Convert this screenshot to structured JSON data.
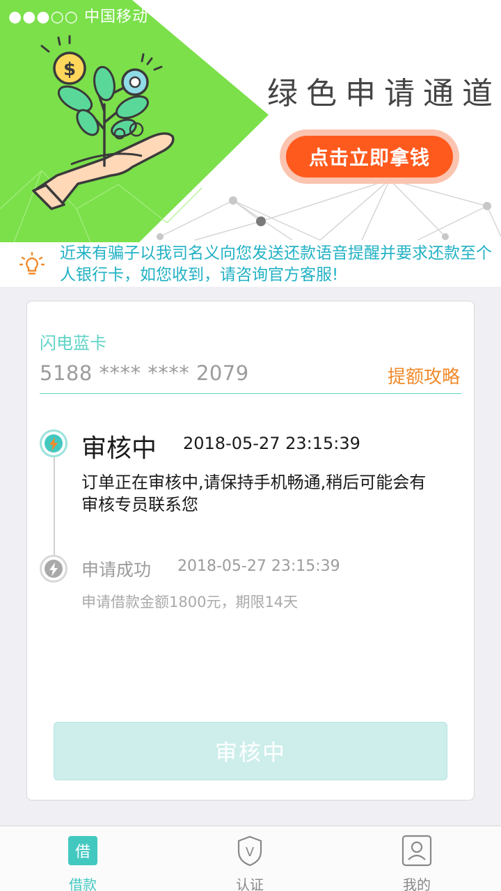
{
  "status_bar": {
    "carrier": "●●●○○ 中国移动"
  },
  "banner": {
    "title": "绿色申请通道",
    "cta_label": "点击立即拿钱",
    "colors": {
      "green": "#7be04a",
      "cta": "#ff5a1e"
    }
  },
  "notice": {
    "icon": "lightbulb-icon",
    "text": "近来有骗子以我司名义向您发送还款语音提醒并要求还款至个人银行卡，如您收到，请咨询官方客服!"
  },
  "card": {
    "name": "闪电蓝卡",
    "number": "5188 **** **** 2079",
    "link_label": "提额攻略"
  },
  "timeline": [
    {
      "title": "审核中",
      "time": "2018-05-27 23:15:39",
      "desc": "订单正在审核中,请保持手机畅通,稍后可能会有审核专员联系您",
      "icon": "lightning-icon"
    },
    {
      "title": "申请成功",
      "time": "2018-05-27 23:15:39",
      "desc": "申请借款金额1800元，期限14天",
      "icon": "lightning-icon"
    }
  ],
  "review_button": {
    "label": "审核中"
  },
  "tabbar": {
    "items": [
      {
        "label": "借款",
        "icon_char": "借",
        "icon": "loan-icon"
      },
      {
        "label": "认证",
        "icon_char": "V",
        "icon": "shield-icon"
      },
      {
        "label": "我的",
        "icon": "person-icon"
      }
    ],
    "accent": "#43c8c0"
  }
}
